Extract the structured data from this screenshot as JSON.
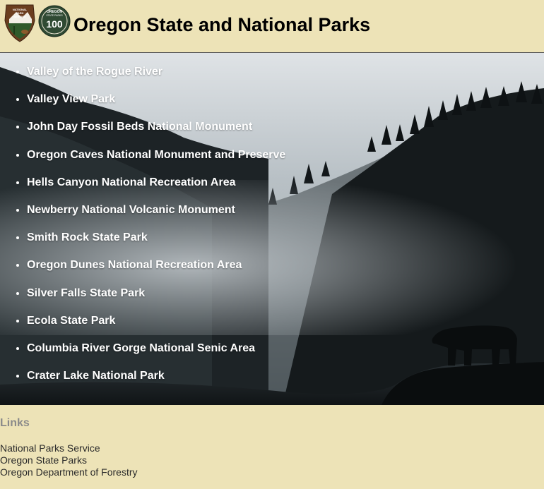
{
  "header": {
    "title": "Oregon State and National Parks",
    "logos": [
      {
        "icon": "nps-arrowhead-logo",
        "lettering": "NATIONAL PARK SERVICE"
      },
      {
        "icon": "oregon-state-parks-100-logo",
        "lettering": "OREGON STATE PARKS 100"
      }
    ]
  },
  "parks": [
    "Valley of the Rogue River",
    "Valley View Park",
    "John Day Fossil Beds National Monument",
    "Oregon Caves National Monument and Preserve",
    "Hells Canyon National Recreation Area",
    "Newberry National Volcanic Monument",
    "Smith Rock State Park",
    "Oregon Dunes National Recreation Area",
    "Silver Falls State Park",
    "Ecola State Park",
    "Columbia River Gorge National Senic Area",
    "Crater Lake National Park"
  ],
  "links": {
    "heading": "Links",
    "items": [
      "National Parks Service",
      "Oregon State Parks",
      "Oregon Department of Forestry"
    ]
  },
  "colors": {
    "page_background": "#ede3b7",
    "link_heading": "#8a8a8a",
    "nps_brown": "#6b3e1f",
    "osp_green": "#2f4a33"
  }
}
